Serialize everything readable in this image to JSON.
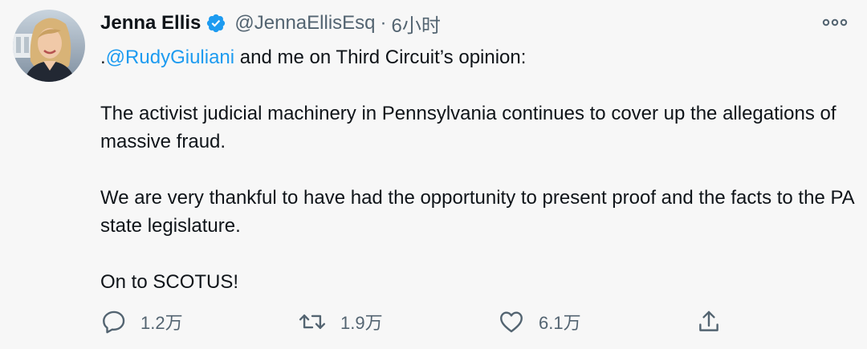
{
  "tweet": {
    "display_name": "Jenna Ellis",
    "verified": true,
    "handle": "@JennaEllisEsq",
    "separator": "·",
    "timestamp": "6小时",
    "body": {
      "line1_prefix": ".",
      "mention": "@RudyGiuliani",
      "line1_suffix": " and me on Third Circuit’s opinion:",
      "para2": "The activist judicial machinery in Pennsylvania continues to cover up the allegations of massive fraud.",
      "para3": "We are very thankful to have had the opportunity to present proof and the facts to the PA state legislature.",
      "para4": "On to SCOTUS!"
    },
    "actions": {
      "reply": {
        "icon": "reply-icon",
        "count": "1.2万"
      },
      "retweet": {
        "icon": "retweet-icon",
        "count": "1.9万"
      },
      "like": {
        "icon": "heart-icon",
        "count": "6.1万"
      },
      "share": {
        "icon": "share-icon"
      }
    },
    "colors": {
      "background": "#f7f7f7",
      "text": "#0f1419",
      "secondary": "#536471",
      "link": "#1d9bf0",
      "verified": "#1d9bf0"
    }
  }
}
